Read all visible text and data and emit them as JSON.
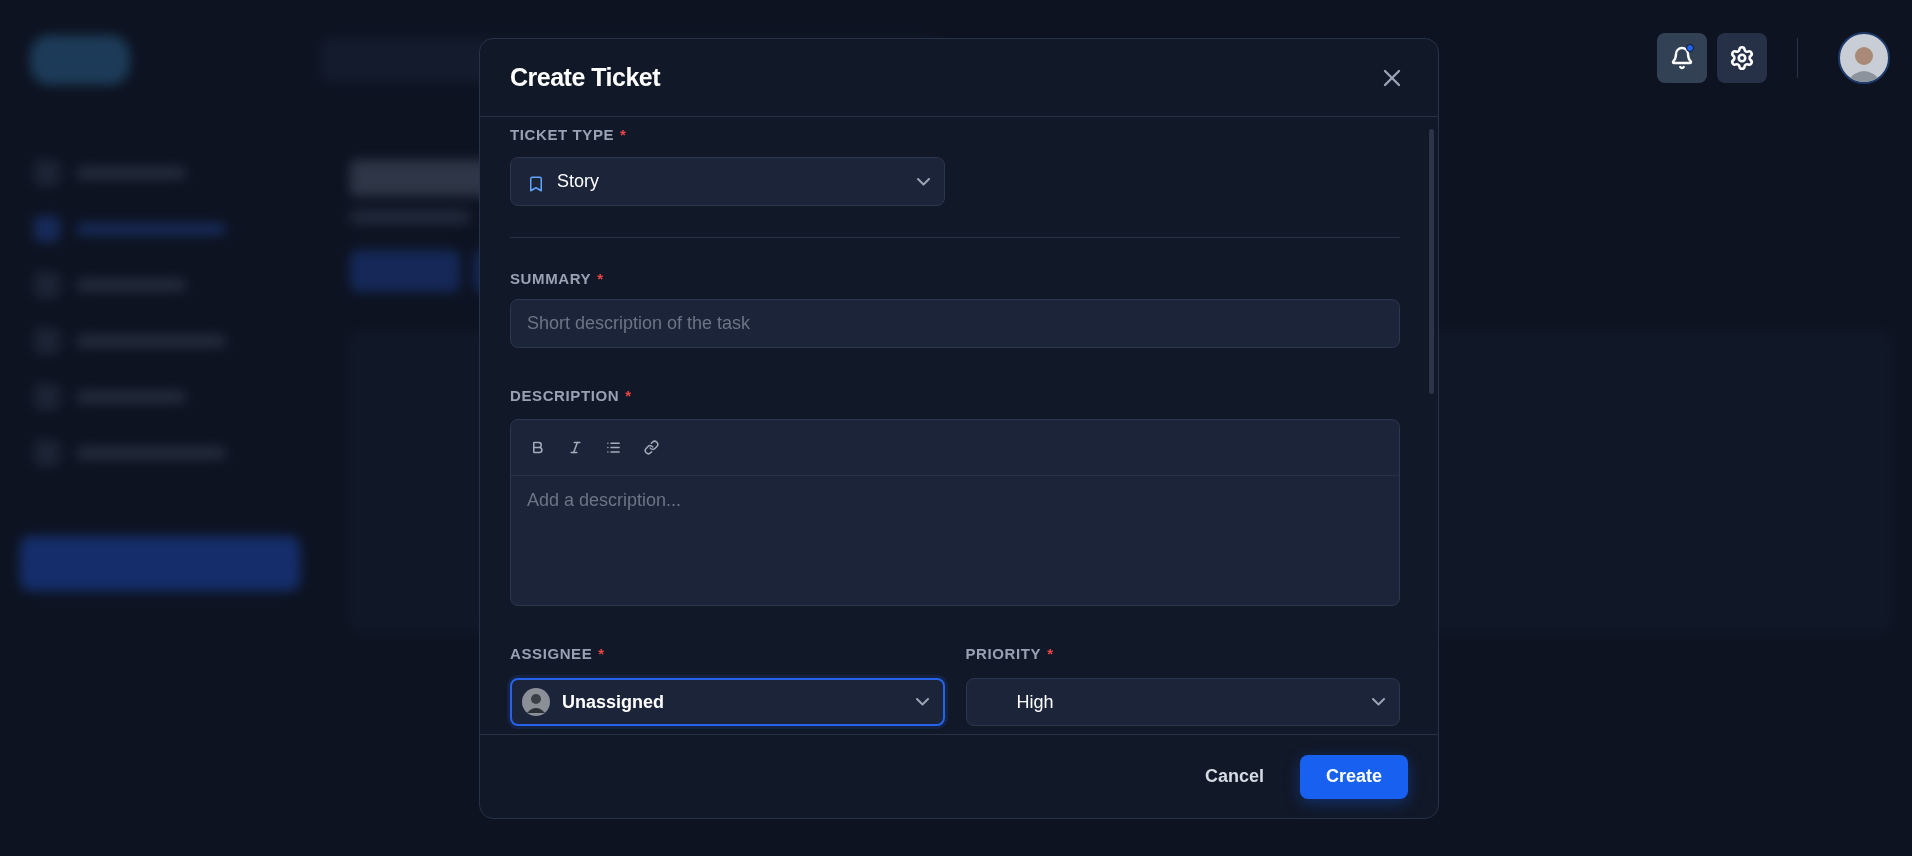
{
  "header": {
    "notifications": {
      "unread": true
    }
  },
  "modal": {
    "title": "Create Ticket",
    "fields": [
      {
        "kind": "select",
        "label": "TICKET TYPE",
        "required_mark": "*",
        "value": "Story",
        "focused": false
      },
      {
        "kind": "text",
        "label": "SUMMARY",
        "required_mark": "*",
        "placeholder": "Short description of the task"
      },
      {
        "kind": "editor",
        "label": "DESCRIPTION",
        "required_mark": "*",
        "placeholder": "Add a description...",
        "tools": [
          {
            "kind": "bold"
          },
          {
            "kind": "italic"
          },
          {
            "kind": "list"
          },
          {
            "kind": "link"
          }
        ]
      }
    ],
    "row": [
      {
        "label": "ASSIGNEE",
        "required_mark": "*",
        "value": "Unassigned",
        "focused": true
      },
      {
        "label": "PRIORITY",
        "required_mark": "*",
        "value": "High",
        "focused": false
      }
    ],
    "buttons": [
      {
        "kind": "secondary",
        "label": "Cancel"
      },
      {
        "kind": "primary",
        "label": "Create"
      }
    ]
  }
}
